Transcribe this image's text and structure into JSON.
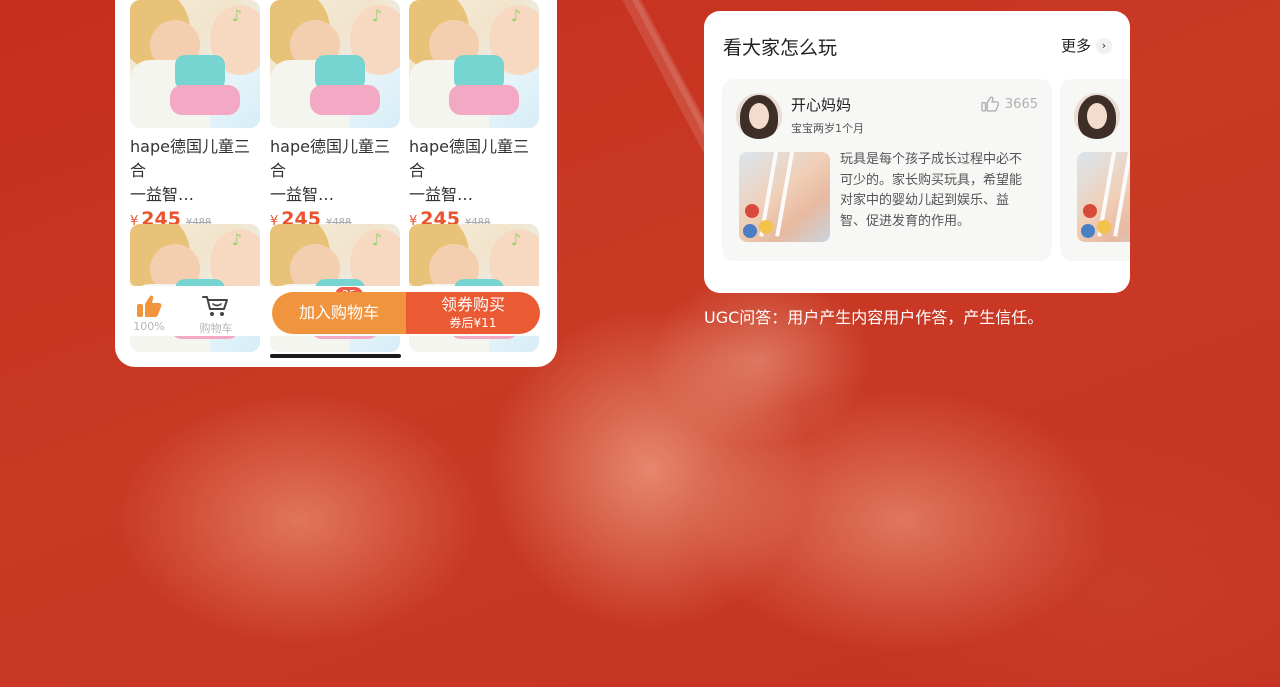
{
  "colors": {
    "background": "#c8321f",
    "accent": "#ea5a33",
    "cart_button": "#f0953d",
    "badge": "#ee5d4a"
  },
  "products": [
    {
      "name_line1": "hape德国儿童三合",
      "name_line2": "一益智…",
      "currency": "¥",
      "price": "245",
      "old_price": "¥488"
    },
    {
      "name_line1": "hape德国儿童三合",
      "name_line2": "一益智…",
      "currency": "¥",
      "price": "245",
      "old_price": "¥488"
    },
    {
      "name_line1": "hape德国儿童三合",
      "name_line2": "一益智…",
      "currency": "¥",
      "price": "245",
      "old_price": "¥488"
    }
  ],
  "bottom_bar": {
    "like_icon": "thumbs-up-icon",
    "like_label": "100%",
    "cart_icon": "cart-icon",
    "cart_label": "购物车",
    "cart_count": "25",
    "add_to_cart": "加入购物车",
    "buy_label": "领券购买",
    "buy_sub": "券后¥11"
  },
  "ugc": {
    "title": "看大家怎么玩",
    "more": "更多",
    "posts": [
      {
        "user": "开心妈妈",
        "subtitle": "宝宝两岁1个月",
        "likes": "3665",
        "lines": [
          "玩具是每个孩子成长过程中必不",
          "可少的。家长购买玩具，希望能",
          "对家中的婴幼儿起到娱乐、益",
          "智、促进发育的作用。"
        ]
      }
    ]
  },
  "caption": "UGC问答：用户产生内容用户作答，产生信任。"
}
